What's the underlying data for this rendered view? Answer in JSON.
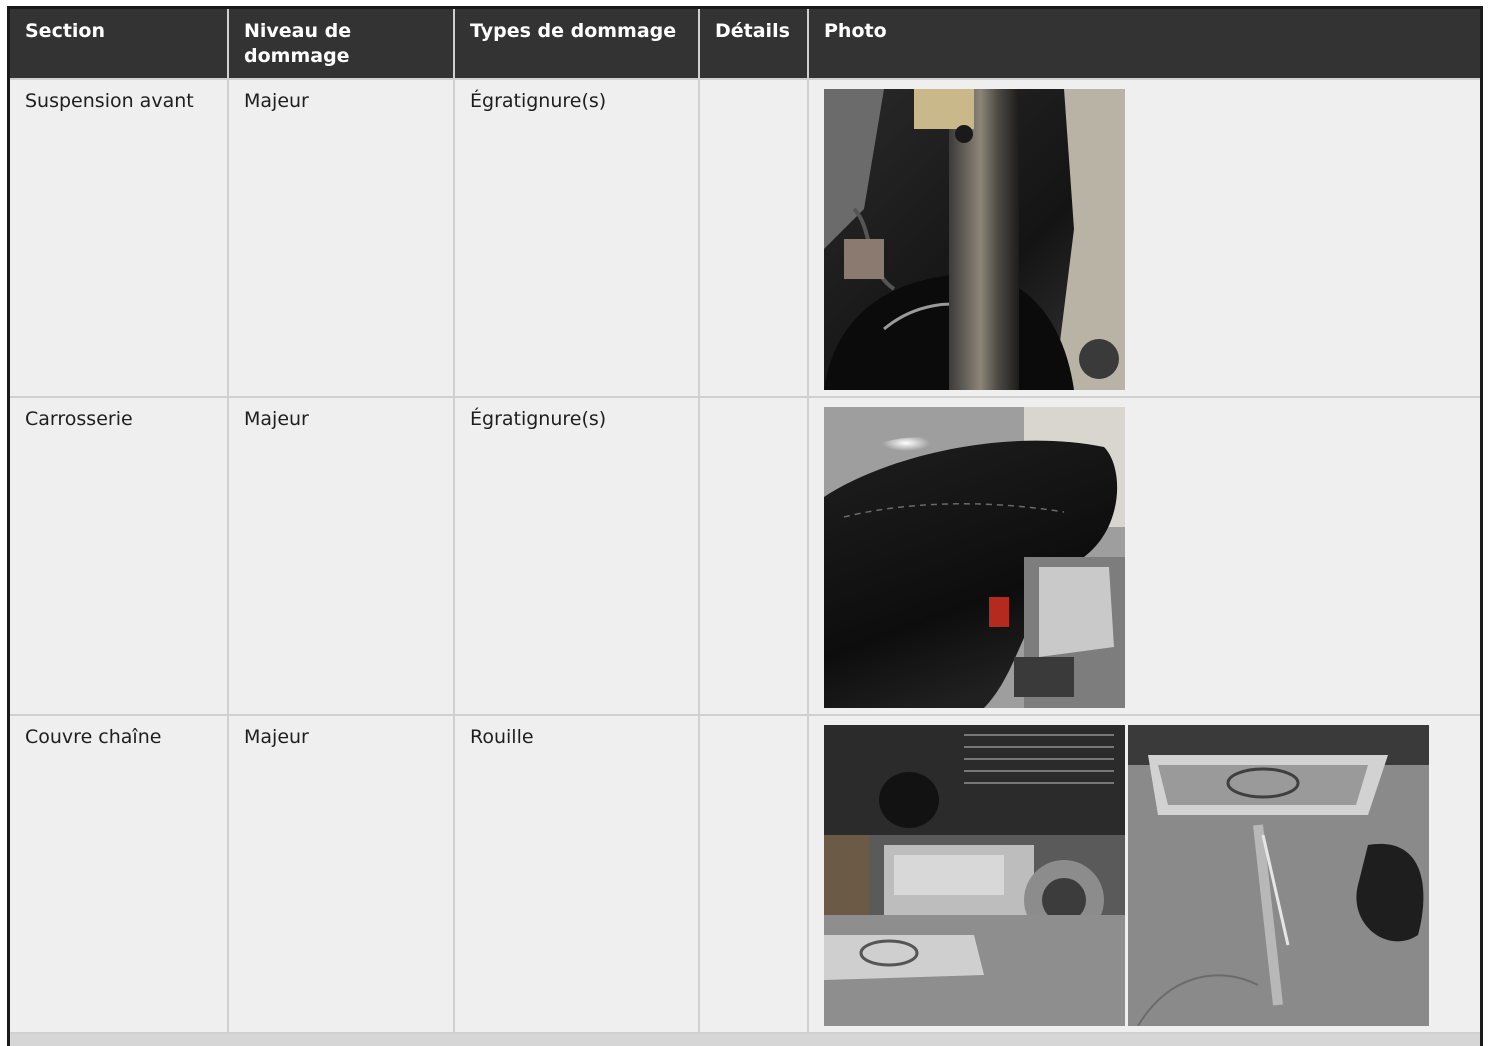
{
  "table": {
    "headers": [
      "Section",
      "Niveau de dommage",
      "Types de dommage",
      "Détails",
      "Photo"
    ],
    "rows": [
      {
        "section": "Suspension avant",
        "niveau": "Majeur",
        "types": "Égratignure(s)",
        "details": "",
        "photos": [
          "photo-front-fork"
        ]
      },
      {
        "section": "Carrosserie",
        "niveau": "Majeur",
        "types": "Égratignure(s)",
        "details": "",
        "photos": [
          "photo-fuel-tank"
        ]
      },
      {
        "section": "Couvre chaîne",
        "niveau": "Majeur",
        "types": "Rouille",
        "details": "",
        "photos": [
          "photo-engine-footboard",
          "photo-footboard-kickstand"
        ]
      }
    ]
  },
  "colors": {
    "header_bg": "#333333",
    "header_text": "#ffffff",
    "cell_bg": "#efefef",
    "grid": "#d0d0d0",
    "frame": "#1a1a1a"
  }
}
